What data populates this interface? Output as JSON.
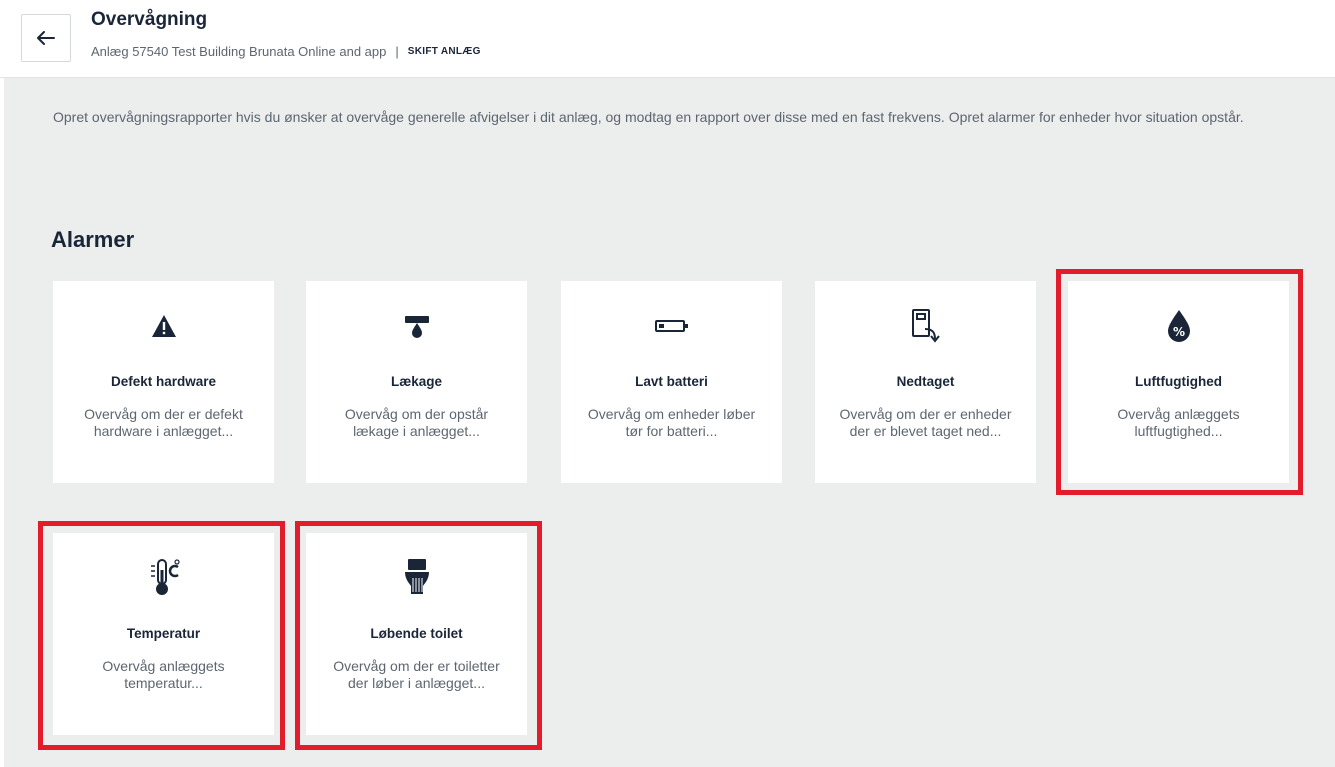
{
  "header": {
    "title": "Overvågning",
    "facility": "Anlæg 57540 Test Building Brunata Online and app",
    "separator": "|",
    "switch_label": "SKIFT ANLÆG"
  },
  "intro": "Opret overvågningsrapporter hvis du ønsker at overvåge generelle afvigelser i dit anlæg, og modtag en rapport over disse med en fast frekvens. Opret alarmer for enheder hvor situation opstår.",
  "section_title": "Alarmer",
  "cards": [
    {
      "icon": "warning-icon",
      "title": "Defekt hardware",
      "desc": "Overvåg om der er defekt hardware i anlægget..."
    },
    {
      "icon": "leak-icon",
      "title": "Lækage",
      "desc": "Overvåg om der opstår lækage i anlægget..."
    },
    {
      "icon": "battery-low-icon",
      "title": "Lavt batteri",
      "desc": "Overvåg om enheder løber tør for batteri..."
    },
    {
      "icon": "device-removed-icon",
      "title": "Nedtaget",
      "desc": "Overvåg om der er enheder der er blevet taget ned..."
    },
    {
      "icon": "humidity-icon",
      "title": "Luftfugtighed",
      "desc": "Overvåg anlæggets luftfugtighed..."
    },
    {
      "icon": "thermometer-icon",
      "title": "Temperatur",
      "desc": "Overvåg anlæggets temperatur..."
    },
    {
      "icon": "toilet-icon",
      "title": "Løbende toilet",
      "desc": "Overvåg om der er toiletter der løber i anlægget..."
    }
  ],
  "colors": {
    "text_dark": "#1a2638",
    "text_muted": "#5d6670",
    "background": "#eceded",
    "highlight": "#e31c2b"
  }
}
